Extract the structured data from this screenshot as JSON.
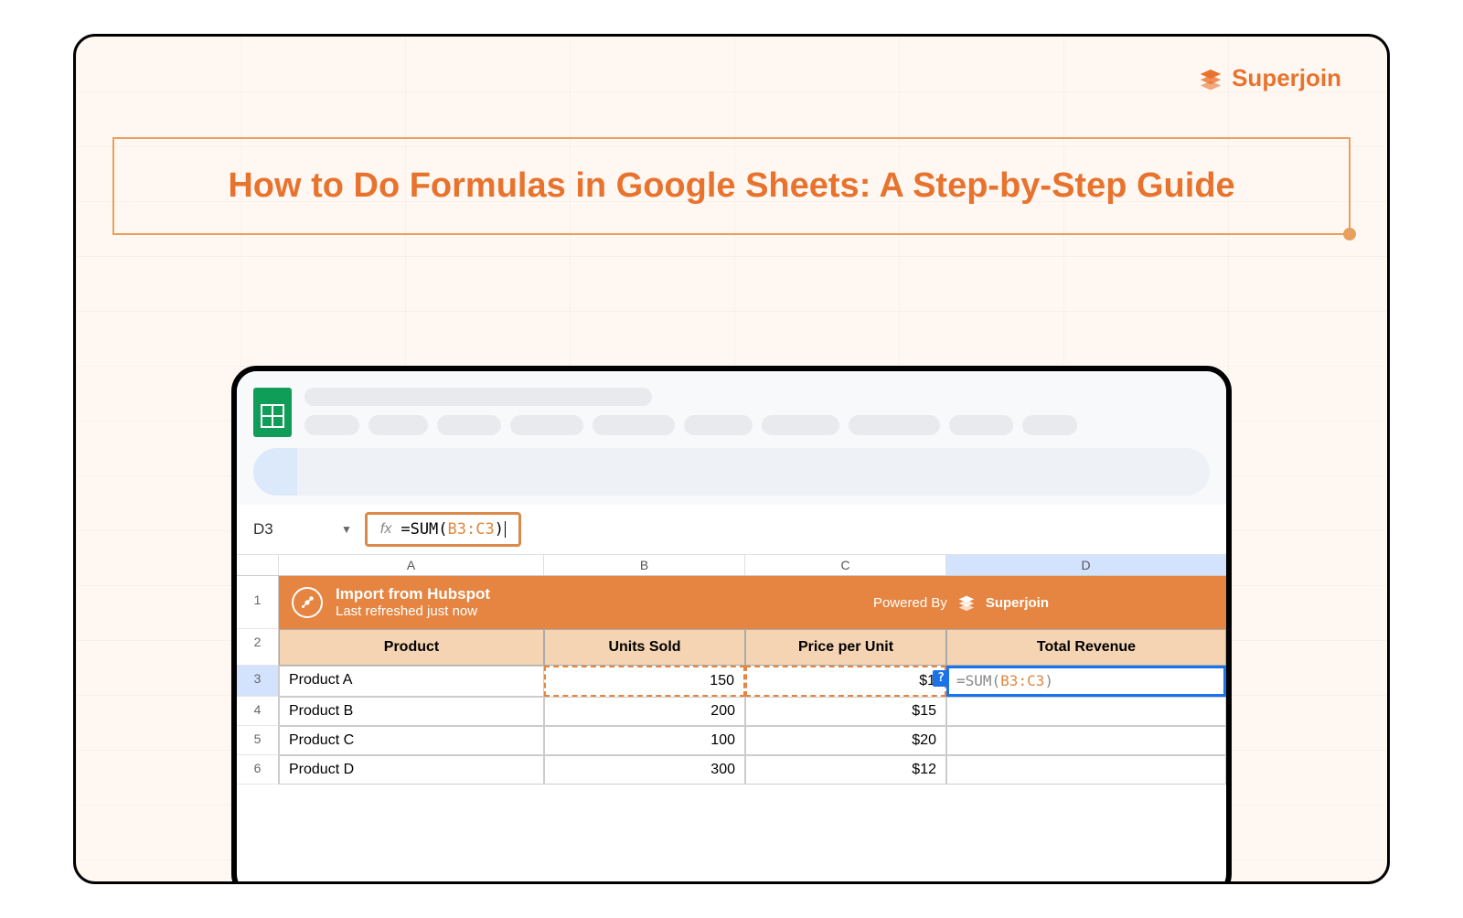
{
  "brand": {
    "name": "Superjoin"
  },
  "title": "How to Do Formulas in Google Sheets: A Step-by-Step Guide",
  "formula_bar": {
    "cell_ref": "D3",
    "fx_label": "fx",
    "formula_prefix": "=SUM(",
    "formula_range": "B3:C3",
    "formula_suffix": ")"
  },
  "columns": [
    "A",
    "B",
    "C",
    "D"
  ],
  "banner": {
    "title": "Import from Hubspot",
    "subtitle": "Last refreshed just now",
    "powered_label": "Powered By",
    "powered_brand": "Superjoin"
  },
  "headers": {
    "a": "Product",
    "b": "Units Sold",
    "c": "Price per Unit",
    "d": "Total Revenue"
  },
  "rows": [
    {
      "num": "3",
      "a": "Product A",
      "b": "150",
      "c": "$1",
      "d_prefix": "=SUM(",
      "d_range": "B3:C3",
      "d_suffix": ")",
      "help": "?"
    },
    {
      "num": "4",
      "a": "Product B",
      "b": "200",
      "c": "$15"
    },
    {
      "num": "5",
      "a": "Product C",
      "b": "100",
      "c": "$20"
    },
    {
      "num": "6",
      "a": "Product D",
      "b": "300",
      "c": "$12"
    }
  ],
  "row_labels": {
    "r1": "1",
    "r2": "2"
  }
}
